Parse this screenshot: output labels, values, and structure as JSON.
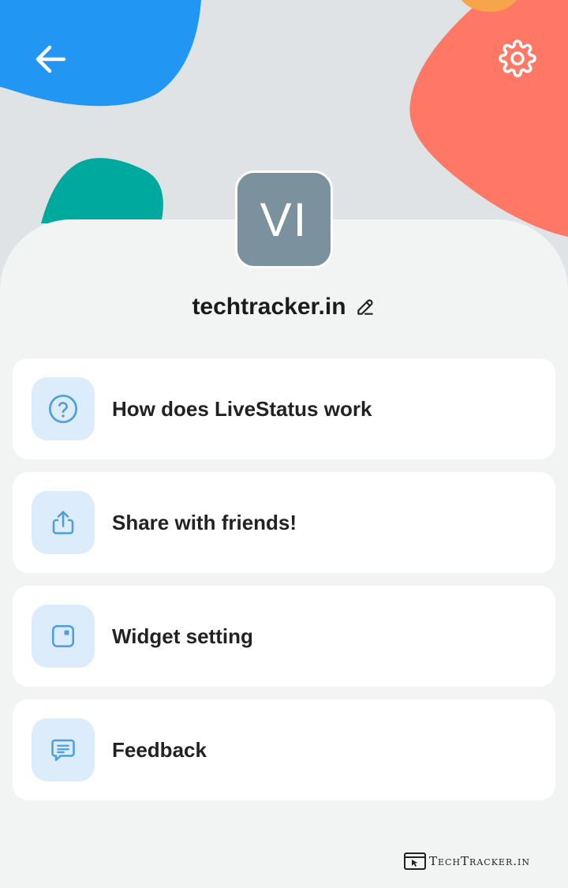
{
  "app": {
    "profile_name": "techtracker.in",
    "avatar_initials": "VI"
  },
  "icons": {
    "back": "arrow-left-icon",
    "settings": "gear-icon",
    "edit": "pencil-icon"
  },
  "menu": {
    "items": [
      {
        "label": "How does LiveStatus work",
        "icon": "help-circle-icon"
      },
      {
        "label": "Share with friends!",
        "icon": "share-icon"
      },
      {
        "label": "Widget setting",
        "icon": "widget-icon"
      },
      {
        "label": "Feedback",
        "icon": "feedback-icon"
      }
    ]
  },
  "watermark": {
    "text": "TechTracker.in"
  },
  "colors": {
    "background": "#dfe3e6",
    "blob_blue": "#2196f3",
    "blob_coral": "#ff7866",
    "blob_teal": "#00a99d",
    "blob_orange": "#f7a54a",
    "avatar": "#7b929e",
    "icon_tile": "#dcecfb",
    "icon_accent": "#4a9fdc"
  }
}
